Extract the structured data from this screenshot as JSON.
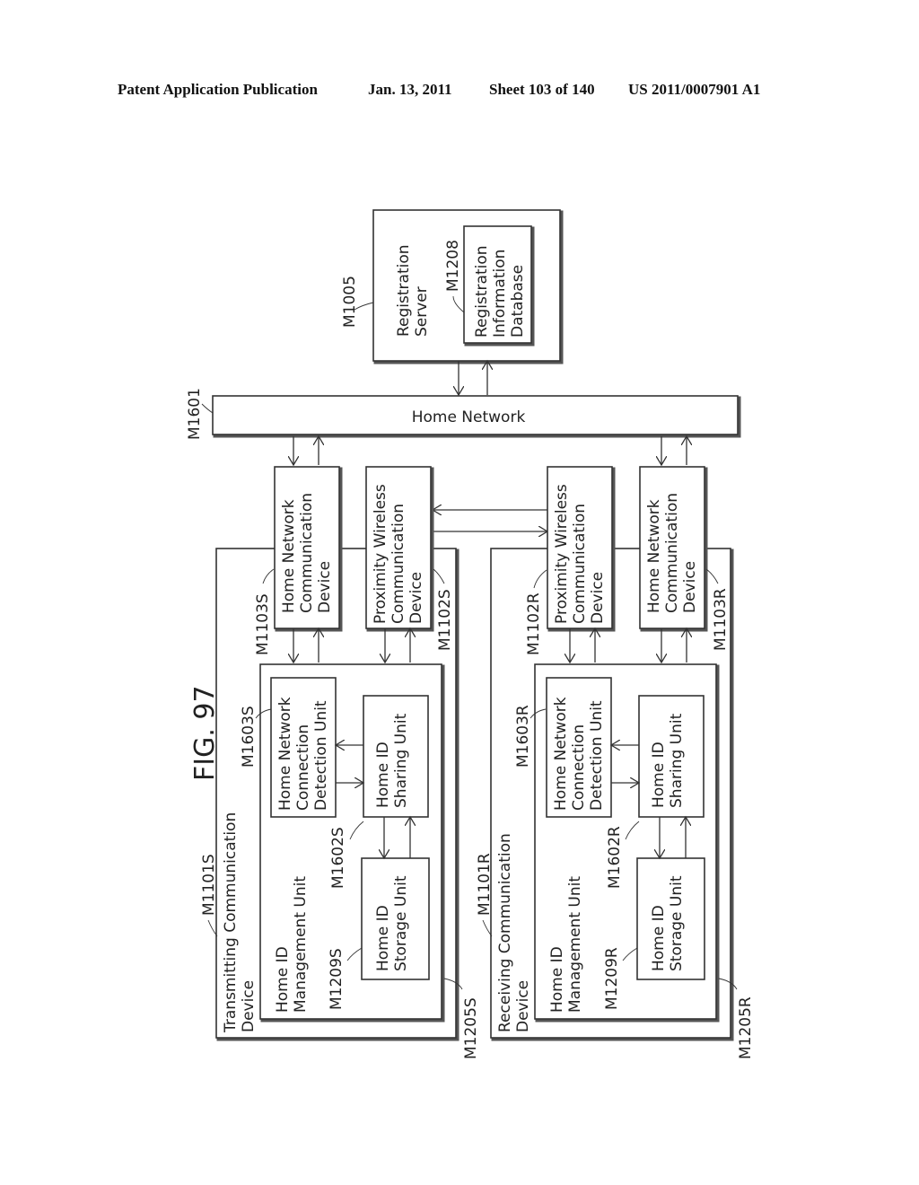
{
  "header": {
    "publication": "Patent Application Publication",
    "date": "Jan. 13, 2011",
    "sheet": "Sheet 103 of 140",
    "number": "US 2011/0007901 A1"
  },
  "figure": {
    "label": "FIG. 97"
  },
  "server": {
    "ref": "M1005",
    "label": [
      "Registration",
      "Server"
    ],
    "db_ref": "M1208",
    "db_label": [
      "Registration",
      "Information",
      "Database"
    ]
  },
  "network": {
    "ref": "M1601",
    "label": "Home Network"
  },
  "transmitting": {
    "ref": "M1101S",
    "label": [
      "Transmitting Communication",
      "Device"
    ],
    "hn_comm_ref": "M1103S",
    "hn_comm_label": [
      "Home Network",
      "Communication",
      "Device"
    ],
    "prox_ref": "M1102S",
    "prox_label": [
      "Proximity Wireless",
      "Communication",
      "Device"
    ],
    "mgmt_ref": "M1205S",
    "mgmt_label": [
      "Home ID",
      "Management Unit"
    ],
    "detect_ref": "M1603S",
    "detect_label": [
      "Home Network",
      "Connection",
      "Detection Unit"
    ],
    "share_ref": "M1602S",
    "share_label": [
      "Home ID",
      "Sharing Unit"
    ],
    "storage_ref": "M1209S",
    "storage_label": [
      "Home ID",
      "Storage Unit"
    ]
  },
  "receiving": {
    "ref": "M1101R",
    "label": [
      "Receiving Communication",
      "Device"
    ],
    "hn_comm_ref": "M1103R",
    "hn_comm_label": [
      "Home Network",
      "Communication",
      "Device"
    ],
    "prox_ref": "M1102R",
    "prox_label": [
      "Proximity Wireless",
      "Communication",
      "Device"
    ],
    "mgmt_ref": "M1205R",
    "mgmt_label": [
      "Home ID",
      "Management Unit"
    ],
    "detect_ref": "M1603R",
    "detect_label": [
      "Home Network",
      "Connection",
      "Detection Unit"
    ],
    "share_ref": "M1602R",
    "share_label": [
      "Home ID",
      "Sharing Unit"
    ],
    "storage_ref": "M1209R",
    "storage_label": [
      "Home ID",
      "Storage Unit"
    ]
  }
}
